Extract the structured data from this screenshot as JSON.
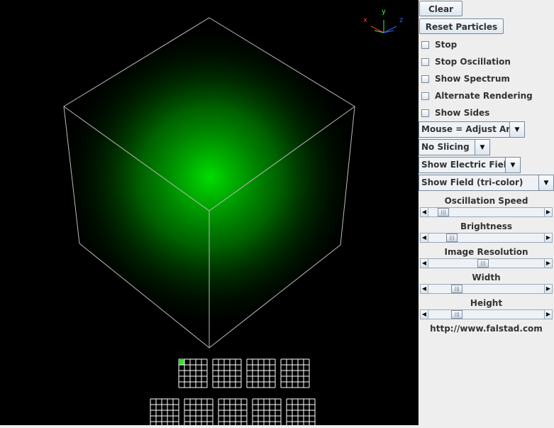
{
  "buttons": {
    "clear": "Clear",
    "reset_particles": "Reset Particles"
  },
  "checkboxes": [
    {
      "label": "Stop",
      "checked": false
    },
    {
      "label": "Stop Oscillation",
      "checked": false
    },
    {
      "label": "Show Spectrum",
      "checked": false
    },
    {
      "label": "Alternate Rendering",
      "checked": false
    },
    {
      "label": "Show Sides",
      "checked": false
    }
  ],
  "dropdowns": {
    "mouse_mode": "Mouse = Adjust Angle",
    "slicing": "No Slicing",
    "field_type": "Show Electric Field",
    "display_mode": "Show Field (tri-color)"
  },
  "sliders": [
    {
      "label": "Oscillation Speed",
      "value": 0.09
    },
    {
      "label": "Brightness",
      "value": 0.17
    },
    {
      "label": "Image Resolution",
      "value": 0.47
    },
    {
      "label": "Width",
      "value": 0.22
    },
    {
      "label": "Height",
      "value": 0.22
    }
  ],
  "footer_url": "http://www.falstad.com",
  "axes": {
    "x": "x",
    "y": "y",
    "z": "z",
    "x_color": "#ff3333",
    "y_color": "#33ff33",
    "z_color": "#3366ff"
  },
  "mode_grid": {
    "rows": [
      4,
      5
    ],
    "selected_row": 0,
    "selected_index": 0,
    "selected_color": "#22ee22"
  },
  "colors": {
    "field": "#00dd00",
    "edges": "#bbbbbb",
    "background": "#000000",
    "panel": "#eeeeee"
  }
}
